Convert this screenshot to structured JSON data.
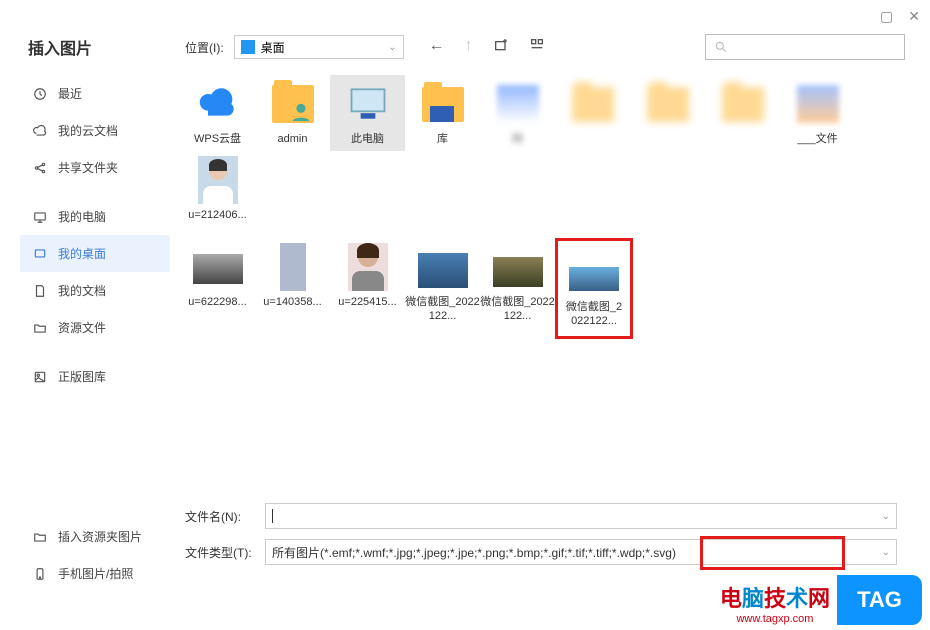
{
  "title": "插入图片",
  "windowControls": {
    "maximize": "▢",
    "close": "✕"
  },
  "toolbar": {
    "locationLabel": "位置(I):",
    "currentFolder": "桌面"
  },
  "sidebar": {
    "items": [
      {
        "name": "recent",
        "label": "最近"
      },
      {
        "name": "cloud",
        "label": "我的云文档"
      },
      {
        "name": "shared",
        "label": "共享文件夹"
      },
      {
        "name": "mycomputer",
        "label": "我的电脑"
      },
      {
        "name": "mydesktop",
        "label": "我的桌面"
      },
      {
        "name": "mydoc",
        "label": "我的文档"
      },
      {
        "name": "resources",
        "label": "资源文件"
      },
      {
        "name": "gallery",
        "label": "正版图库"
      }
    ],
    "bottom": [
      {
        "name": "insert-resource",
        "label": "插入资源夹图片"
      },
      {
        "name": "mobile-photo",
        "label": "手机图片/拍照"
      }
    ]
  },
  "files": {
    "row1": [
      {
        "name": "wps-cloud",
        "label": "WPS云盘",
        "type": "cloud"
      },
      {
        "name": "admin",
        "label": "admin",
        "type": "user-folder"
      },
      {
        "name": "thispc",
        "label": "此电脑",
        "type": "pc",
        "selected": true
      },
      {
        "name": "library",
        "label": "库",
        "type": "lib"
      },
      {
        "name": "blur1",
        "label": "网",
        "type": "folder"
      },
      {
        "name": "blur2",
        "label": "",
        "type": "folder"
      },
      {
        "name": "blur3",
        "label": "",
        "type": "folder"
      },
      {
        "name": "blur4",
        "label": "",
        "type": "folder"
      },
      {
        "name": "blur5",
        "label": "___文件",
        "type": "folder"
      },
      {
        "name": "portrait",
        "label": "u=212406...",
        "type": "portrait"
      }
    ],
    "row2": [
      {
        "name": "img1",
        "label": "u=622298...",
        "type": "landscape"
      },
      {
        "name": "img2",
        "label": "u=140358...",
        "type": "phone"
      },
      {
        "name": "img3",
        "label": "u=225415...",
        "type": "person"
      },
      {
        "name": "wx1",
        "label": "微信截图_2022122...",
        "type": "bridge"
      },
      {
        "name": "wx2",
        "label": "微信截图_2022122...",
        "type": "city"
      },
      {
        "name": "wx3",
        "label": "微信截图_2022122...",
        "type": "skyline",
        "highlighted": true
      }
    ]
  },
  "bottom": {
    "fileNameLabel": "文件名(N):",
    "fileNameValue": "",
    "fileTypeLabel": "文件类型(T):",
    "fileTypeValue": "所有图片(*.emf;*.wmf;*.jpg;*.jpeg;*.jpe;*.png;*.bmp;*.gif;*.tif;*.tiff;*.wdp;*.svg)"
  },
  "watermark": {
    "text": "电脑技术网",
    "url": "www.tagxp.com",
    "tag": "TAG"
  }
}
